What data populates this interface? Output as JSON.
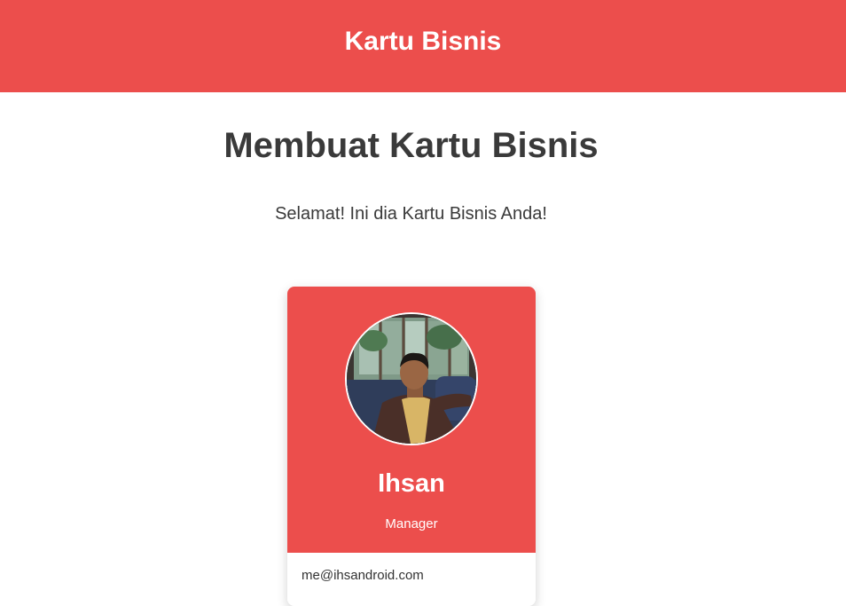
{
  "header": {
    "title": "Kartu Bisnis"
  },
  "main": {
    "heading": "Membuat Kartu Bisnis",
    "subtitle": "Selamat! Ini dia Kartu Bisnis Anda!"
  },
  "card": {
    "name": "Ihsan",
    "role": "Manager",
    "email": "me@ihsandroid.com",
    "avatar_icon": "profile-photo"
  },
  "colors": {
    "accent": "#ec4e4c",
    "text": "#3a3a3a",
    "background": "#ffffff"
  }
}
